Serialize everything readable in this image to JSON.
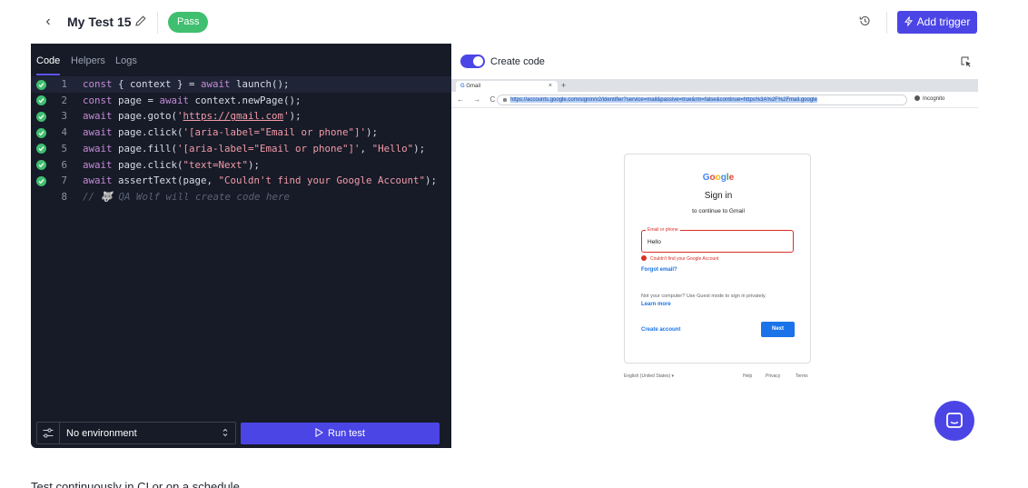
{
  "header": {
    "title": "My Test 15",
    "status": "Pass",
    "add_trigger_label": "Add trigger",
    "icons": {
      "back": "chevron-left-icon",
      "edit": "pencil-icon",
      "history": "history-icon",
      "trigger": "bolt-icon"
    }
  },
  "editor": {
    "tabs": [
      {
        "label": "Code",
        "active": true
      },
      {
        "label": "Helpers",
        "active": false
      },
      {
        "label": "Logs",
        "active": false
      }
    ],
    "lines": [
      {
        "n": "1",
        "passed": true,
        "code": "const { context } = await launch();"
      },
      {
        "n": "2",
        "passed": true,
        "code": "const page = await context.newPage();"
      },
      {
        "n": "3",
        "passed": true,
        "code": "await page.goto('https://gmail.com');"
      },
      {
        "n": "4",
        "passed": true,
        "code": "await page.click('[aria-label=\"Email or phone\"]');"
      },
      {
        "n": "5",
        "passed": true,
        "code": "await page.fill('[aria-label=\"Email or phone\"]', \"Hello\");"
      },
      {
        "n": "6",
        "passed": true,
        "code": "await page.click(\"text=Next\");"
      },
      {
        "n": "7",
        "passed": true,
        "code": "await assertText(page, \"Couldn't find your Google Account\");"
      },
      {
        "n": "8",
        "passed": false,
        "code": "// 🐺 QA Wolf will create code here"
      }
    ],
    "environment": "No environment",
    "run_label": "Run test"
  },
  "preview": {
    "toggle_label": "Create code",
    "toggle_on": true,
    "browser": {
      "tab_title": "Gmail",
      "tab_close": "×",
      "new_tab": "+",
      "nav": "← → C",
      "url": "https://accounts.google.com/signin/v2/identifier?service=mail&passive=true&rm=false&continue=https%3A%2F%2Fmail.google",
      "incognito": "Incognito"
    },
    "signin": {
      "logo": "Google",
      "title": "Sign in",
      "subtitle": "to continue to Gmail",
      "field_label": "Email or phone",
      "field_value": "Hello",
      "error": "Couldn't find your Google Account",
      "forgot": "Forgot email?",
      "guest": "Not your computer? Use Guest mode to sign in privately.",
      "learn_more": "Learn more",
      "create_account": "Create account",
      "next": "Next",
      "footer": {
        "language": "English (United States) ▾",
        "help": "Help",
        "privacy": "Privacy",
        "terms": "Terms"
      }
    }
  },
  "footer_text": "Test continuously in CI or on a schedule",
  "colors": {
    "accent": "#4b45e6",
    "pass": "#3fbf6f",
    "editor_bg": "#161b27",
    "error": "#d93025",
    "google_blue": "#1a73e8"
  }
}
